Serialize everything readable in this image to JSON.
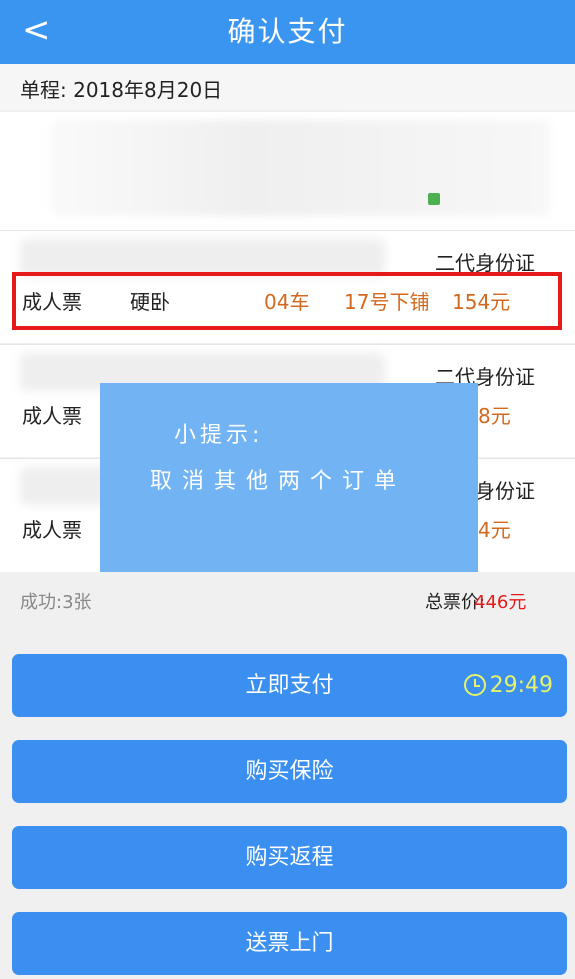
{
  "header": {
    "back_symbol": "<",
    "title": "确认支付"
  },
  "trip": {
    "date_label": "单程: 2018年8月20日"
  },
  "passengers": [
    {
      "id_type": "二代身份证",
      "ticket_type": "成人票",
      "seat_class": "硬卧",
      "car": "04车",
      "seat": "17号下铺",
      "price": "154元"
    },
    {
      "id_type": "二代身份证",
      "ticket_type": "成人票",
      "price_partial": "8元"
    },
    {
      "id_type": "身份证",
      "ticket_type": "成人票",
      "price_partial": "4元"
    }
  ],
  "tip": {
    "line1": "小提示:",
    "line2": "取消其他两个订单"
  },
  "summary": {
    "success_label": "成功:3张",
    "total_label": "总票价:",
    "total_value": "446元"
  },
  "buttons": {
    "pay_now": "立即支付",
    "timer": "29:49",
    "buy_insurance": "购买保险",
    "buy_return": "购买返程",
    "deliver": "送票上门"
  },
  "colors": {
    "accent": "#3a95f0",
    "price": "#d2691e",
    "highlight": "#e51a1a",
    "timer": "#e6f26b"
  }
}
